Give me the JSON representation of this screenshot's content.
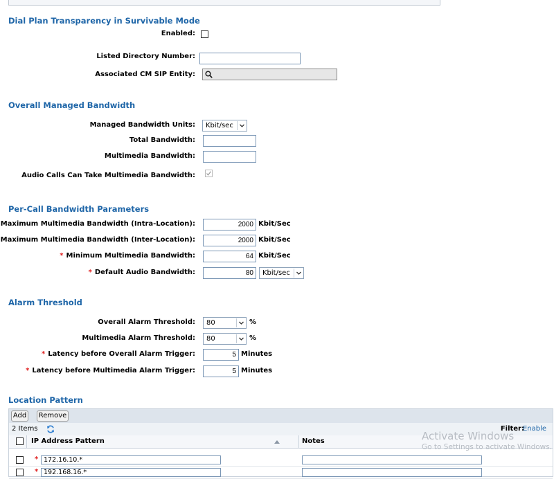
{
  "dial_plan": {
    "title": "Dial Plan Transparency in Survivable Mode",
    "enabled_label": "Enabled:",
    "enabled_checked": false,
    "ldn_label": "Listed Directory Number:",
    "ldn_value": "",
    "sip_entity_label": "Associated CM SIP Entity:",
    "sip_entity_icon": "search-icon"
  },
  "bandwidth": {
    "title": "Overall Managed Bandwidth",
    "units_label": "Managed Bandwidth Units:",
    "units_value": "Kbit/sec",
    "total_label": "Total Bandwidth:",
    "total_value": "",
    "multimedia_label": "Multimedia Bandwidth:",
    "multimedia_value": "",
    "audio_label": "Audio Calls Can Take Multimedia Bandwidth:",
    "audio_checked": true
  },
  "per_call": {
    "title": "Per-Call Bandwidth Parameters",
    "max_intra_label": "Maximum Multimedia Bandwidth (Intra-Location):",
    "max_intra_value": "2000",
    "max_intra_unit": "Kbit/Sec",
    "max_inter_label": "Maximum Multimedia Bandwidth (Inter-Location):",
    "max_inter_value": "2000",
    "max_inter_unit": "Kbit/Sec",
    "min_label": "Minimum Multimedia Bandwidth:",
    "min_value": "64",
    "min_unit": "Kbit/Sec",
    "audio_label": "Default Audio Bandwidth:",
    "audio_value": "80",
    "audio_unit": "Kbit/sec"
  },
  "alarm": {
    "title": "Alarm Threshold",
    "overall_label": "Overall Alarm Threshold:",
    "overall_value": "80",
    "percent": "%",
    "multimedia_label": "Multimedia Alarm Threshold:",
    "multimedia_value": "80",
    "lat_overall_label": "Latency before Overall Alarm Trigger:",
    "lat_overall_value": "5",
    "lat_multimedia_label": "Latency before Multimedia Alarm Trigger:",
    "lat_multimedia_value": "5",
    "minutes": "Minutes"
  },
  "location_pattern": {
    "title": "Location Pattern",
    "add_label": "Add",
    "remove_label": "Remove",
    "items_count": "2 Items",
    "filter_label": "Filter:",
    "filter_link": "Enable",
    "col_pattern": "IP Address Pattern",
    "col_notes": "Notes",
    "rows": [
      {
        "pattern": "172.16.10.*",
        "notes": ""
      },
      {
        "pattern": "192.168.16.*",
        "notes": ""
      }
    ]
  },
  "watermark": {
    "line1": "Activate Windows",
    "line2": "Go to Settings to activate Windows."
  },
  "required_marker": "*",
  "colors": {
    "section_title": "#1f66a8",
    "link": "#1f66a8",
    "required": "#e02020"
  }
}
